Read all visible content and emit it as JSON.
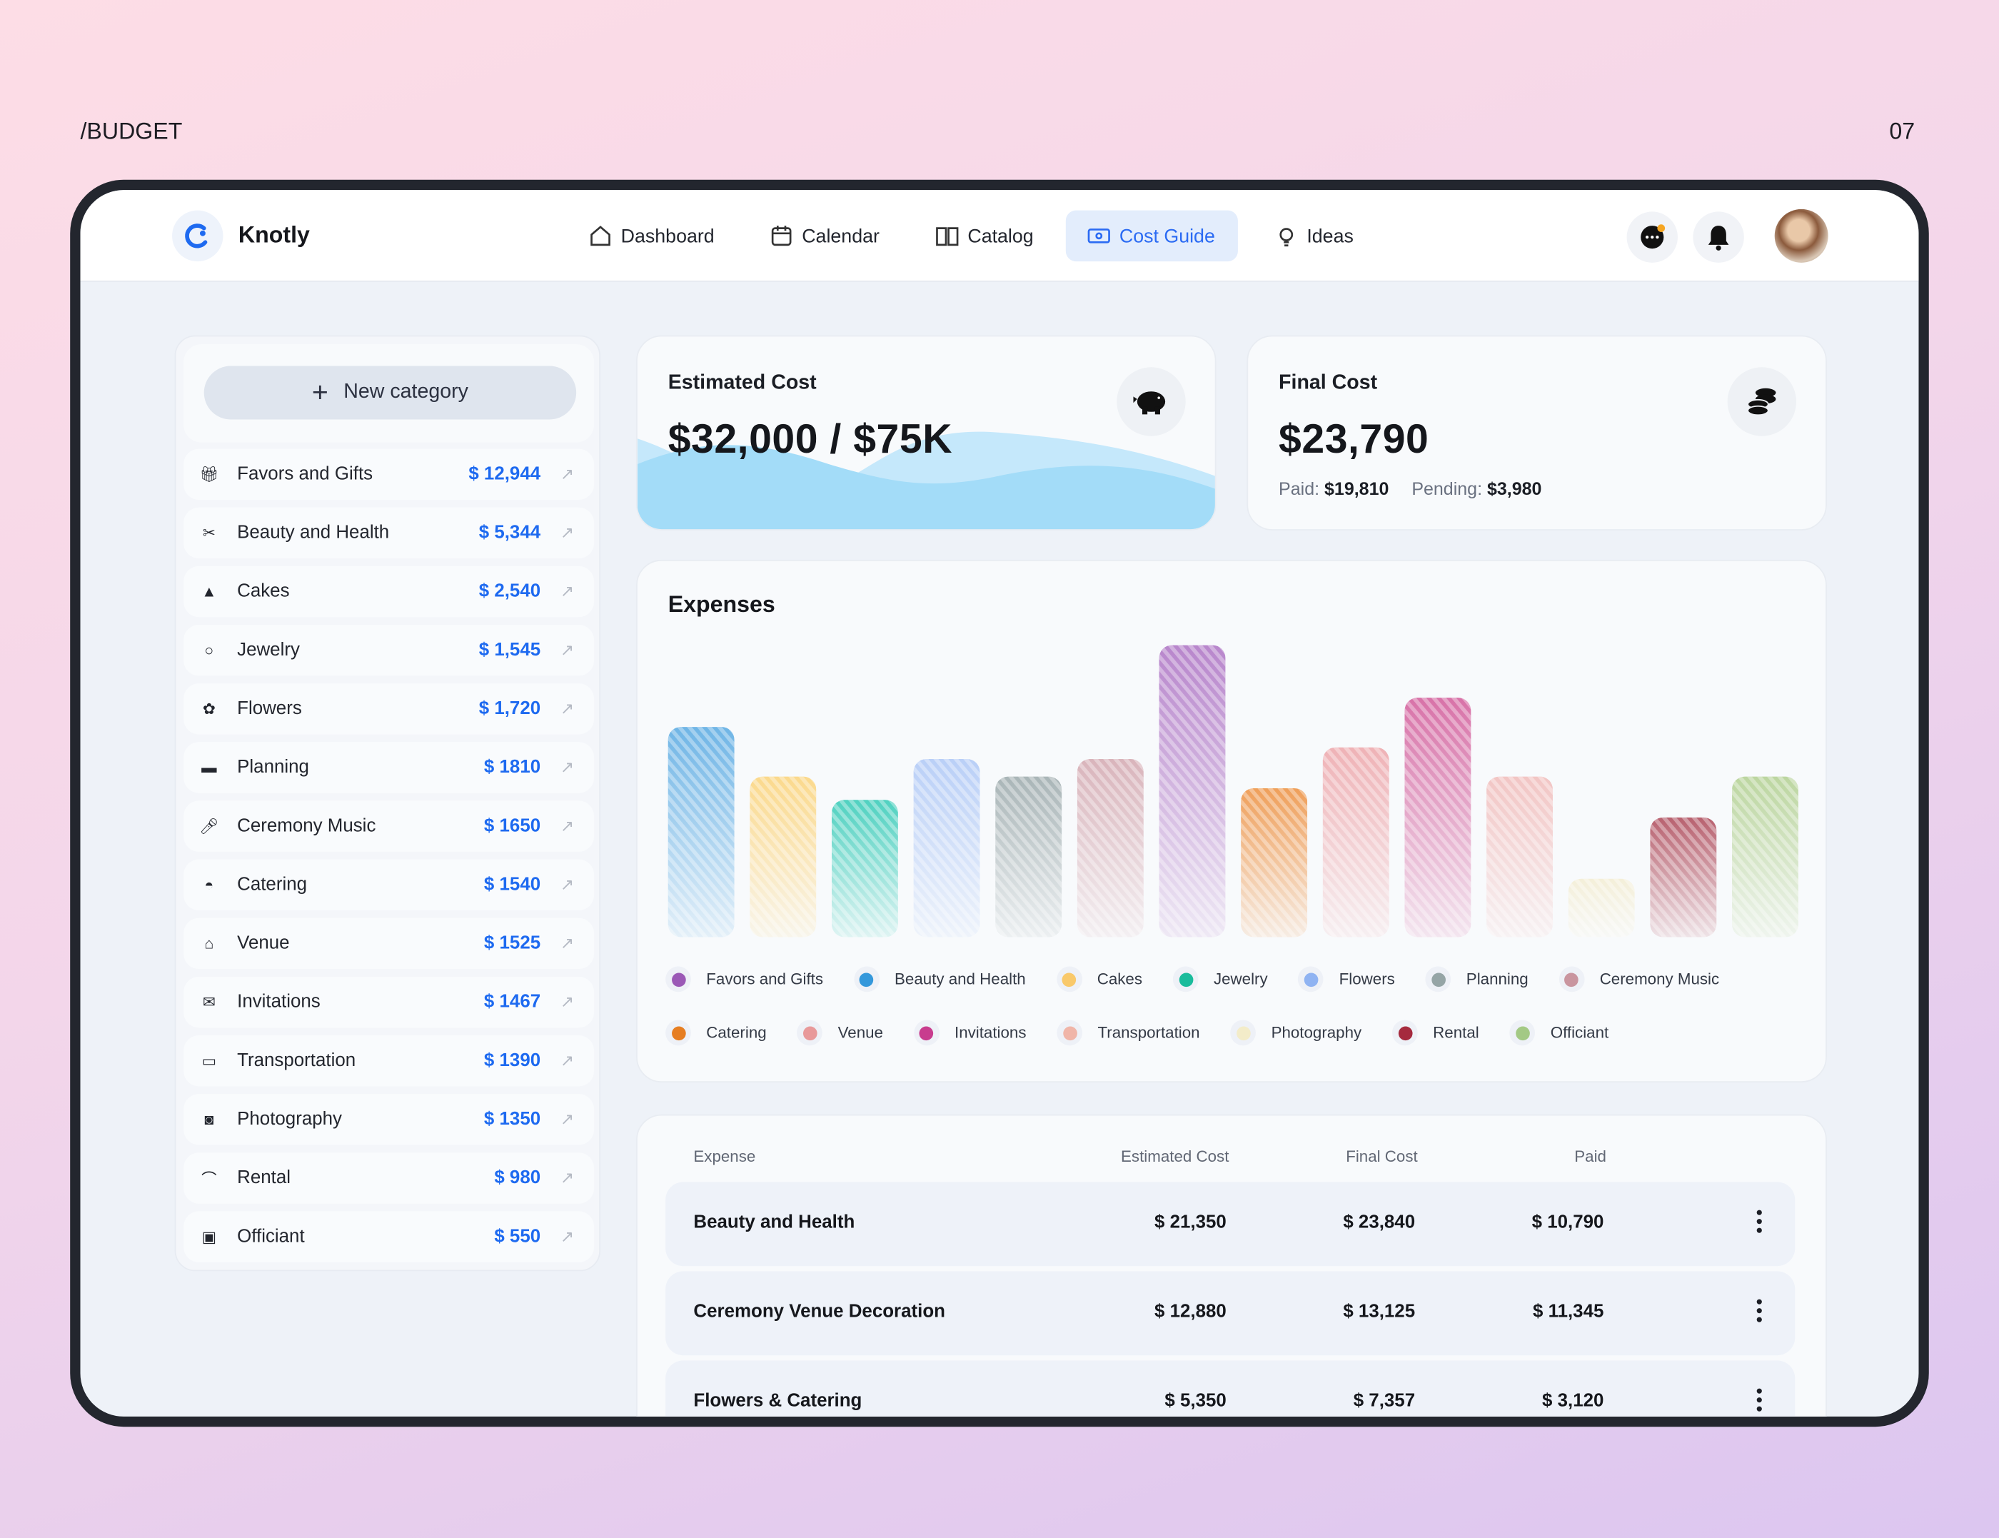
{
  "page": {
    "section_label": "/BUDGET",
    "page_number": "07"
  },
  "app": {
    "name": "Knotly",
    "accent": "#2b6bf3"
  },
  "nav": [
    {
      "label": "Dashboard",
      "icon": "home-icon",
      "active": false
    },
    {
      "label": "Calendar",
      "icon": "calendar-icon",
      "active": false
    },
    {
      "label": "Catalog",
      "icon": "book-icon",
      "active": false
    },
    {
      "label": "Cost Guide",
      "icon": "money-icon",
      "active": true
    },
    {
      "label": "Ideas",
      "icon": "lightbulb-icon",
      "active": false
    }
  ],
  "header_actions": {
    "chat_icon": "chat-icon",
    "bell_icon": "bell-icon",
    "avatar": "user-avatar"
  },
  "sidebar": {
    "new_category_label": "New category",
    "categories": [
      {
        "label": "Favors and Gifts",
        "amount": "$ 12,944",
        "icon": "gift-icon"
      },
      {
        "label": "Beauty and Health",
        "amount": "$ 5,344",
        "icon": "scissors-icon"
      },
      {
        "label": "Cakes",
        "amount": "$ 2,540",
        "icon": "cake-icon"
      },
      {
        "label": "Jewelry",
        "amount": "$ 1,545",
        "icon": "ring-icon"
      },
      {
        "label": "Flowers",
        "amount": "$ 1,720",
        "icon": "flower-icon"
      },
      {
        "label": "Planning",
        "amount": "$ 1810",
        "icon": "planner-icon"
      },
      {
        "label": "Ceremony Music",
        "amount": "$ 1650",
        "icon": "microphone-icon"
      },
      {
        "label": "Catering",
        "amount": "$ 1540",
        "icon": "cloche-icon"
      },
      {
        "label": "Venue",
        "amount": "$ 1525",
        "icon": "house-icon"
      },
      {
        "label": "Invitations",
        "amount": "$ 1467",
        "icon": "envelope-icon"
      },
      {
        "label": "Transportation",
        "amount": "$ 1390",
        "icon": "bus-icon"
      },
      {
        "label": "Photography",
        "amount": "$ 1350",
        "icon": "camera-icon"
      },
      {
        "label": "Rental",
        "amount": "$ 980",
        "icon": "tent-icon"
      },
      {
        "label": "Officiant",
        "amount": "$ 550",
        "icon": "id-badge-icon"
      }
    ]
  },
  "estimated": {
    "title": "Estimated Cost",
    "value": "$32,000 / $75K",
    "icon": "piggy-bank-icon"
  },
  "final": {
    "title": "Final Cost",
    "value": "$23,790",
    "paid_label": "Paid:",
    "paid": "$19,810",
    "pending_label": "Pending:",
    "pending": "$3,980",
    "icon": "coins-icon"
  },
  "expenses": {
    "title": "Expenses"
  },
  "chart_data": {
    "type": "bar",
    "title": "Expenses",
    "note_values_relative": true,
    "values": [
      72,
      55,
      47,
      61,
      55,
      61,
      100,
      51,
      65,
      82,
      55,
      20,
      41,
      55
    ],
    "bar_colors": [
      "#6fb5e6",
      "#fbd98c",
      "#4fd1c0",
      "#b9cff7",
      "#a9b5b7",
      "#d9b4bb",
      "#b886cc",
      "#ef9f5a",
      "#efb2b6",
      "#d872a8",
      "#f2c5c4",
      "#f4efd9",
      "#b8616f",
      "#bcd6a0"
    ],
    "grid": false,
    "legend_position": "bottom",
    "legend": [
      {
        "label": "Favors and Gifts",
        "color": "#9b59b6"
      },
      {
        "label": "Beauty and Health",
        "color": "#3498db"
      },
      {
        "label": "Cakes",
        "color": "#f9c96b"
      },
      {
        "label": "Jewelry",
        "color": "#1abc9c"
      },
      {
        "label": "Flowers",
        "color": "#8fb3f2"
      },
      {
        "label": "Planning",
        "color": "#95a5a6"
      },
      {
        "label": "Ceremony Music",
        "color": "#c9959f"
      },
      {
        "label": "Catering",
        "color": "#e67e22"
      },
      {
        "label": "Venue",
        "color": "#e8999a"
      },
      {
        "label": "Invitations",
        "color": "#c83c8e"
      },
      {
        "label": "Transportation",
        "color": "#f0b5a8"
      },
      {
        "label": "Photography",
        "color": "#f3ecc9"
      },
      {
        "label": "Rental",
        "color": "#a52a3e"
      },
      {
        "label": "Officiant",
        "color": "#a3c985"
      }
    ]
  },
  "table": {
    "headers": [
      "Expense",
      "Estimated Cost",
      "Final Cost",
      "Paid"
    ],
    "rows": [
      {
        "expense": "Beauty and Health",
        "estimated": "$ 21,350",
        "final": "$ 23,840",
        "paid": "$ 10,790"
      },
      {
        "expense": "Ceremony Venue Decoration",
        "estimated": "$ 12,880",
        "final": "$ 13,125",
        "paid": "$ 11,345"
      },
      {
        "expense": "Flowers & Catering",
        "estimated": "$ 5,350",
        "final": "$ 7,357",
        "paid": "$ 3,120"
      }
    ]
  }
}
